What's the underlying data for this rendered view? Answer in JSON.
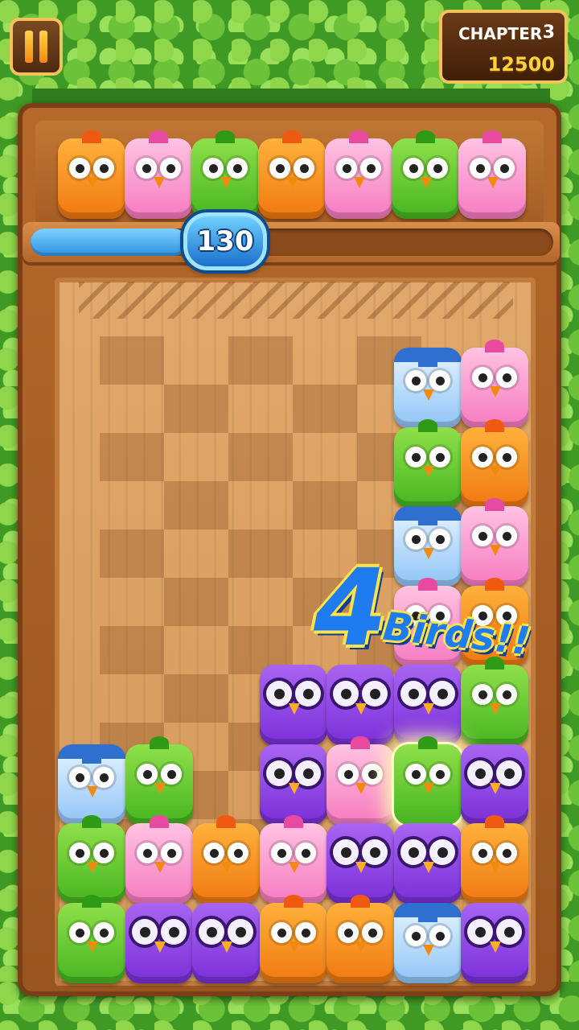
{
  "hud": {
    "chapter_label": "CHAPTER",
    "chapter_number": "3",
    "score": "12500",
    "moves_remaining": "130",
    "progress_fraction": 0.3
  },
  "combo": {
    "count": "4",
    "text": "Birds!!"
  },
  "colors": {
    "orange": "#f07810",
    "pink": "#f67ac0",
    "green": "#46b520",
    "blue": "#8fc4f6",
    "purple": "#7a2fd8"
  },
  "icons": {
    "pause": "pause-icon"
  },
  "queue": [
    "orange",
    "pink",
    "green",
    "orange",
    "pink",
    "green",
    "pink"
  ],
  "grid_columns": 7,
  "grid_rows": 8,
  "grid": [
    [
      null,
      null,
      null,
      null,
      null,
      "blue",
      "pink"
    ],
    [
      null,
      null,
      null,
      null,
      null,
      "green",
      "orange"
    ],
    [
      null,
      null,
      null,
      null,
      null,
      "blue",
      "pink"
    ],
    [
      null,
      null,
      null,
      null,
      null,
      "pink",
      "orange"
    ],
    [
      null,
      null,
      null,
      "purple",
      "purple",
      "purple",
      "green"
    ],
    [
      "blue",
      "green",
      null,
      "purple",
      "pink",
      "green",
      "purple"
    ],
    [
      "green",
      "pink",
      "orange",
      "pink",
      "purple",
      "purple",
      "orange"
    ],
    [
      "green",
      "purple",
      "purple",
      "orange",
      "orange",
      "blue",
      "purple"
    ]
  ],
  "highlighted_cell": {
    "row": 5,
    "col": 5
  }
}
